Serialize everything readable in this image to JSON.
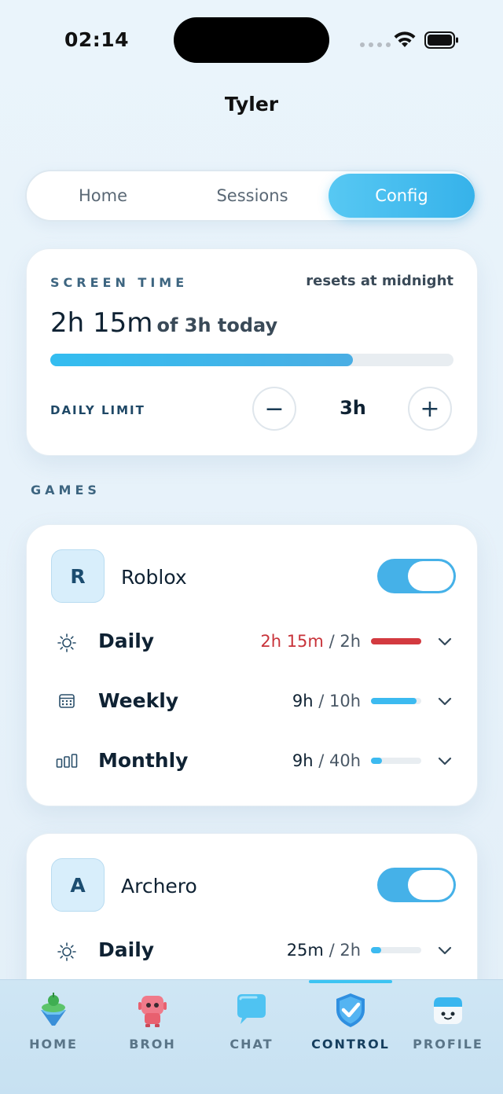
{
  "status_bar": {
    "time": "02:14"
  },
  "header": {
    "title": "Tyler"
  },
  "tabs": [
    {
      "label": "Home",
      "active": false
    },
    {
      "label": "Sessions",
      "active": false
    },
    {
      "label": "Config",
      "active": true
    }
  ],
  "screen_time": {
    "section_label": "SCREEN TIME",
    "reset_note": "resets at midnight",
    "used": "2h 15m",
    "of_text": "of 3h today",
    "progress_fraction": 0.75,
    "limit_label": "DAILY LIMIT",
    "limit_value": "3h",
    "decrease_symbol": "−",
    "increase_symbol": "+"
  },
  "games_label": "GAMES",
  "games": [
    {
      "initial": "R",
      "name": "Roblox",
      "enabled": true,
      "limits": [
        {
          "icon": "sun-icon",
          "label": "Daily",
          "used": "2h 15m",
          "sep": "/",
          "limit": "2h",
          "fraction": 1.0,
          "over": true
        },
        {
          "icon": "calendar-icon",
          "label": "Weekly",
          "used": "9h",
          "sep": "/",
          "limit": "10h",
          "fraction": 0.9,
          "over": false
        },
        {
          "icon": "bar-chart-icon",
          "label": "Monthly",
          "used": "9h",
          "sep": "/",
          "limit": "40h",
          "fraction": 0.225,
          "over": false
        }
      ]
    },
    {
      "initial": "A",
      "name": "Archero",
      "enabled": true,
      "limits": [
        {
          "icon": "sun-icon",
          "label": "Daily",
          "used": "25m",
          "sep": "/",
          "limit": "2h",
          "fraction": 0.21,
          "over": false
        }
      ]
    }
  ],
  "nav": [
    {
      "label": "HOME",
      "icon": "island-icon",
      "active": false
    },
    {
      "label": "BROH",
      "icon": "robot-icon",
      "active": false
    },
    {
      "label": "CHAT",
      "icon": "chat-bubble-icon",
      "active": false
    },
    {
      "label": "CONTROL",
      "icon": "shield-check-icon",
      "active": true
    },
    {
      "label": "PROFILE",
      "icon": "cube-face-icon",
      "active": false
    }
  ],
  "colors": {
    "accent": "#36b2ea",
    "over_limit": "#c8333a",
    "text_dark": "#0f2233"
  }
}
